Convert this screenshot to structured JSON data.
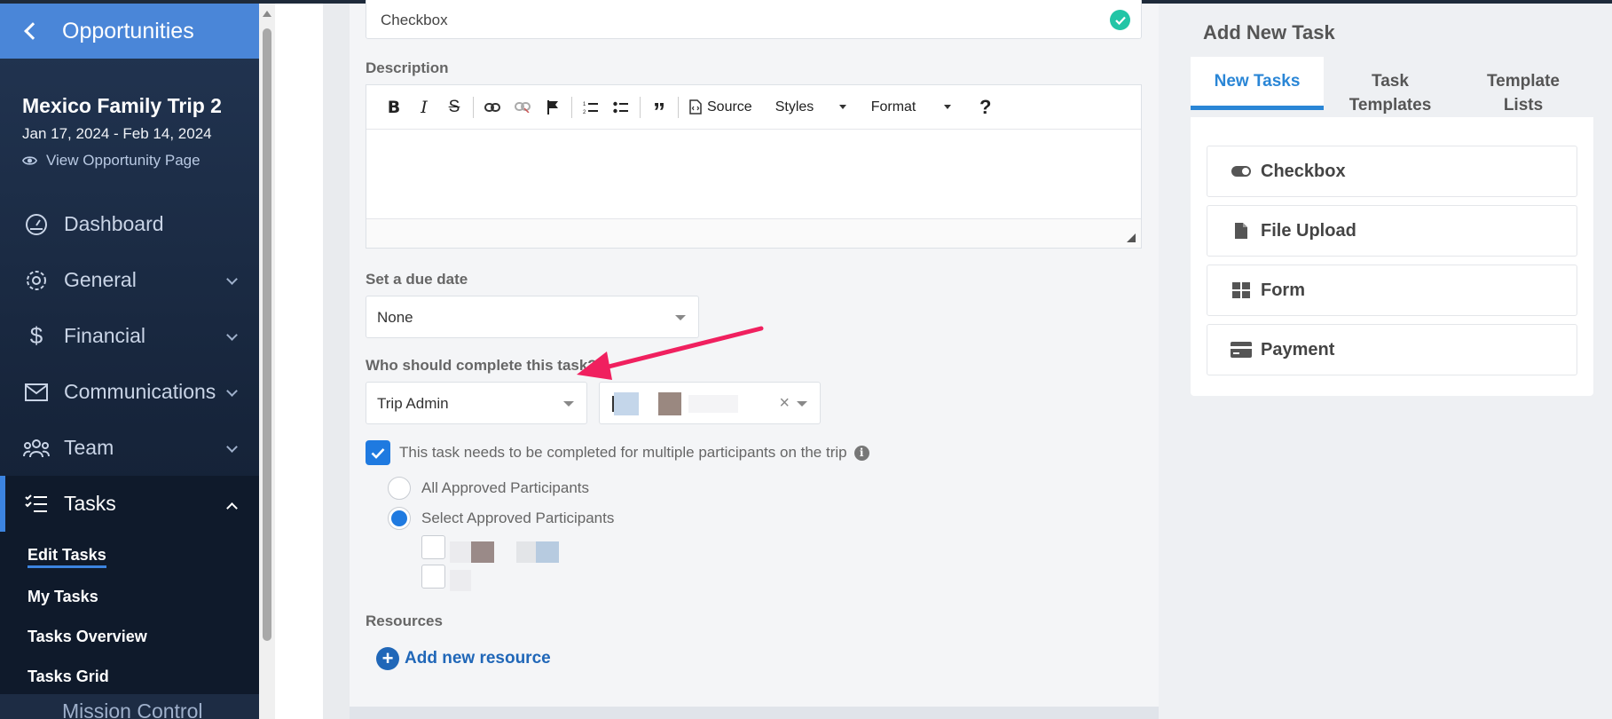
{
  "sidebar": {
    "back_label": "Opportunities",
    "trip": {
      "name": "Mexico Family Trip 2",
      "dates": "Jan 17, 2024 - Feb 14, 2024",
      "view_link": "View Opportunity Page"
    },
    "nav": [
      {
        "label": "Dashboard",
        "icon": "dashboard-icon"
      },
      {
        "label": "General",
        "icon": "gear-icon"
      },
      {
        "label": "Financial",
        "icon": "dollar-icon"
      },
      {
        "label": "Communications",
        "icon": "envelope-icon"
      },
      {
        "label": "Team",
        "icon": "team-icon"
      },
      {
        "label": "Tasks",
        "icon": "tasks-icon"
      }
    ],
    "tasks_sub": [
      "Edit Tasks",
      "My Tasks",
      "Tasks Overview",
      "Tasks Grid"
    ],
    "bottom_item": "Mission Control",
    "accent_color": "#3c84e0"
  },
  "form": {
    "title_value": "Checkbox",
    "description_label": "Description",
    "toolbar": {
      "source": "Source",
      "styles": "Styles",
      "format": "Format"
    },
    "due_date_label": "Set a due date",
    "due_date_value": "None",
    "who_label": "Who should complete this task?",
    "who_value": "Trip Admin",
    "multi_label": "This task needs to be completed for multiple participants on the trip",
    "radio_all": "All Approved Participants",
    "radio_select": "Select Approved Participants",
    "resources_label": "Resources",
    "add_resource": "Add new resource"
  },
  "right_panel": {
    "title": "Add New Task",
    "tabs": [
      "New Tasks",
      "Task Templates",
      "Template Lists"
    ],
    "tab_lines": [
      [
        "New Tasks"
      ],
      [
        "Task",
        "Templates"
      ],
      [
        "Template",
        "Lists"
      ]
    ],
    "options": [
      {
        "label": "Checkbox",
        "icon": "toggle-icon"
      },
      {
        "label": "File Upload",
        "icon": "file-icon"
      },
      {
        "label": "Form",
        "icon": "grid-icon"
      },
      {
        "label": "Payment",
        "icon": "credit-card-icon"
      }
    ]
  },
  "colors": {
    "primary": "#1f7ae0",
    "success": "#22c5a6",
    "annotation_arrow": "#f0205f"
  }
}
